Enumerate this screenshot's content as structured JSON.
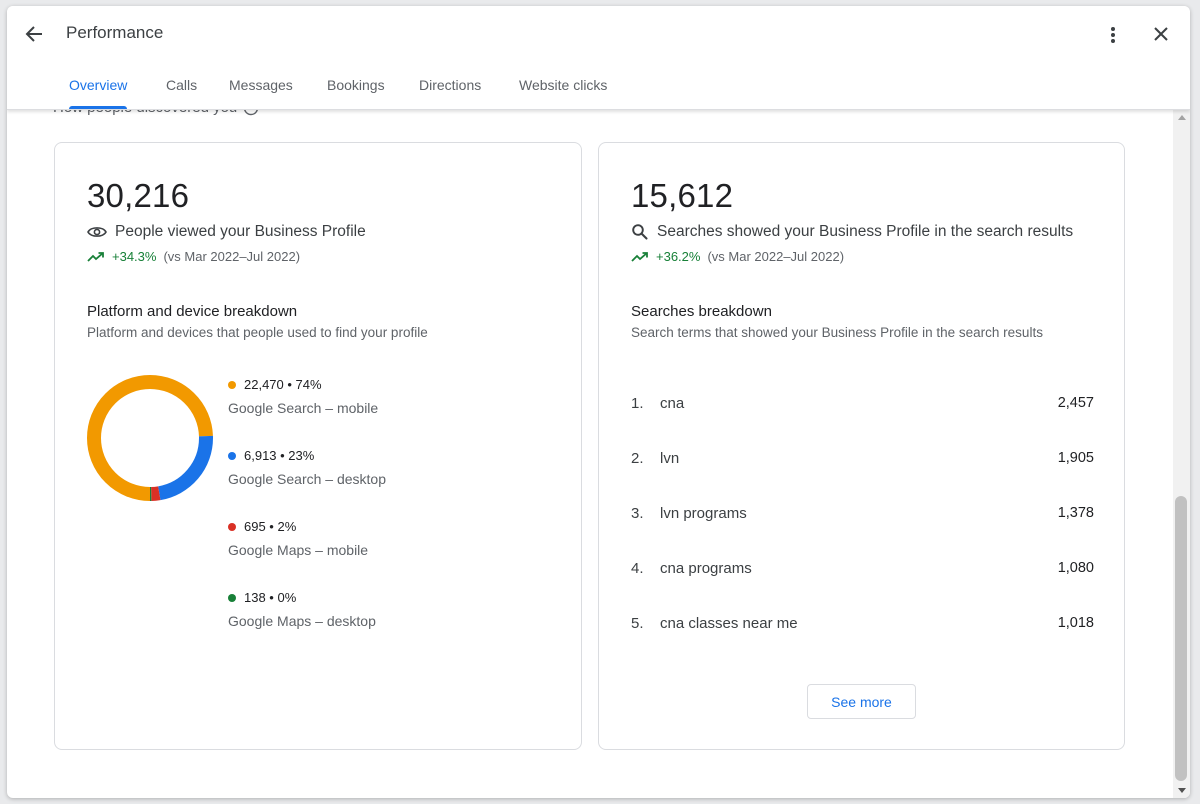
{
  "header": {
    "title": "Performance",
    "back_icon": "arrow-back-icon",
    "more_icon": "more-vert-icon",
    "close_icon": "close-icon"
  },
  "tabs": [
    {
      "label": "Overview",
      "active": true
    },
    {
      "label": "Calls",
      "active": false
    },
    {
      "label": "Messages",
      "active": false
    },
    {
      "label": "Bookings",
      "active": false
    },
    {
      "label": "Directions",
      "active": false
    },
    {
      "label": "Website clicks",
      "active": false
    }
  ],
  "section": {
    "heading": "How people discovered you"
  },
  "views_card": {
    "total": "30,216",
    "label": "People viewed your Business Profile",
    "icon": "eye-icon",
    "trend_pct": "+34.3%",
    "trend_compare": "(vs Mar 2022–Jul 2022)",
    "breakdown_title": "Platform and device breakdown",
    "breakdown_subtitle": "Platform and devices that people used to find your profile",
    "chart_data": {
      "type": "pie",
      "categories": [
        "Google Search – mobile",
        "Google Search – desktop",
        "Google Maps – mobile",
        "Google Maps – desktop"
      ],
      "values": [
        22470,
        6913,
        695,
        138
      ],
      "colors": [
        "#f29900",
        "#1a73e8",
        "#d93025",
        "#188038"
      ]
    },
    "legend": [
      {
        "value_text": "22,470 • 74%",
        "label": "Google Search – mobile",
        "color": "#f29900"
      },
      {
        "value_text": "6,913 • 23%",
        "label": "Google Search – desktop",
        "color": "#1a73e8"
      },
      {
        "value_text": "695 • 2%",
        "label": "Google Maps – mobile",
        "color": "#d93025"
      },
      {
        "value_text": "138 • 0%",
        "label": "Google Maps – desktop",
        "color": "#188038"
      }
    ]
  },
  "searches_card": {
    "total": "15,612",
    "label": "Searches showed your Business Profile in the search results",
    "icon": "search-icon",
    "trend_pct": "+36.2%",
    "trend_compare": "(vs Mar 2022–Jul 2022)",
    "breakdown_title": "Searches breakdown",
    "breakdown_subtitle": "Search terms that showed your Business Profile in the search results",
    "terms": [
      {
        "rank": "1.",
        "term": "cna",
        "count": "2,457"
      },
      {
        "rank": "2.",
        "term": "lvn",
        "count": "1,905"
      },
      {
        "rank": "3.",
        "term": "lvn programs",
        "count": "1,378"
      },
      {
        "rank": "4.",
        "term": "cna programs",
        "count": "1,080"
      },
      {
        "rank": "5.",
        "term": "cna classes near me",
        "count": "1,018"
      }
    ],
    "see_more_label": "See more"
  },
  "colors": {
    "accent": "#1a73e8",
    "positive": "#188038"
  }
}
